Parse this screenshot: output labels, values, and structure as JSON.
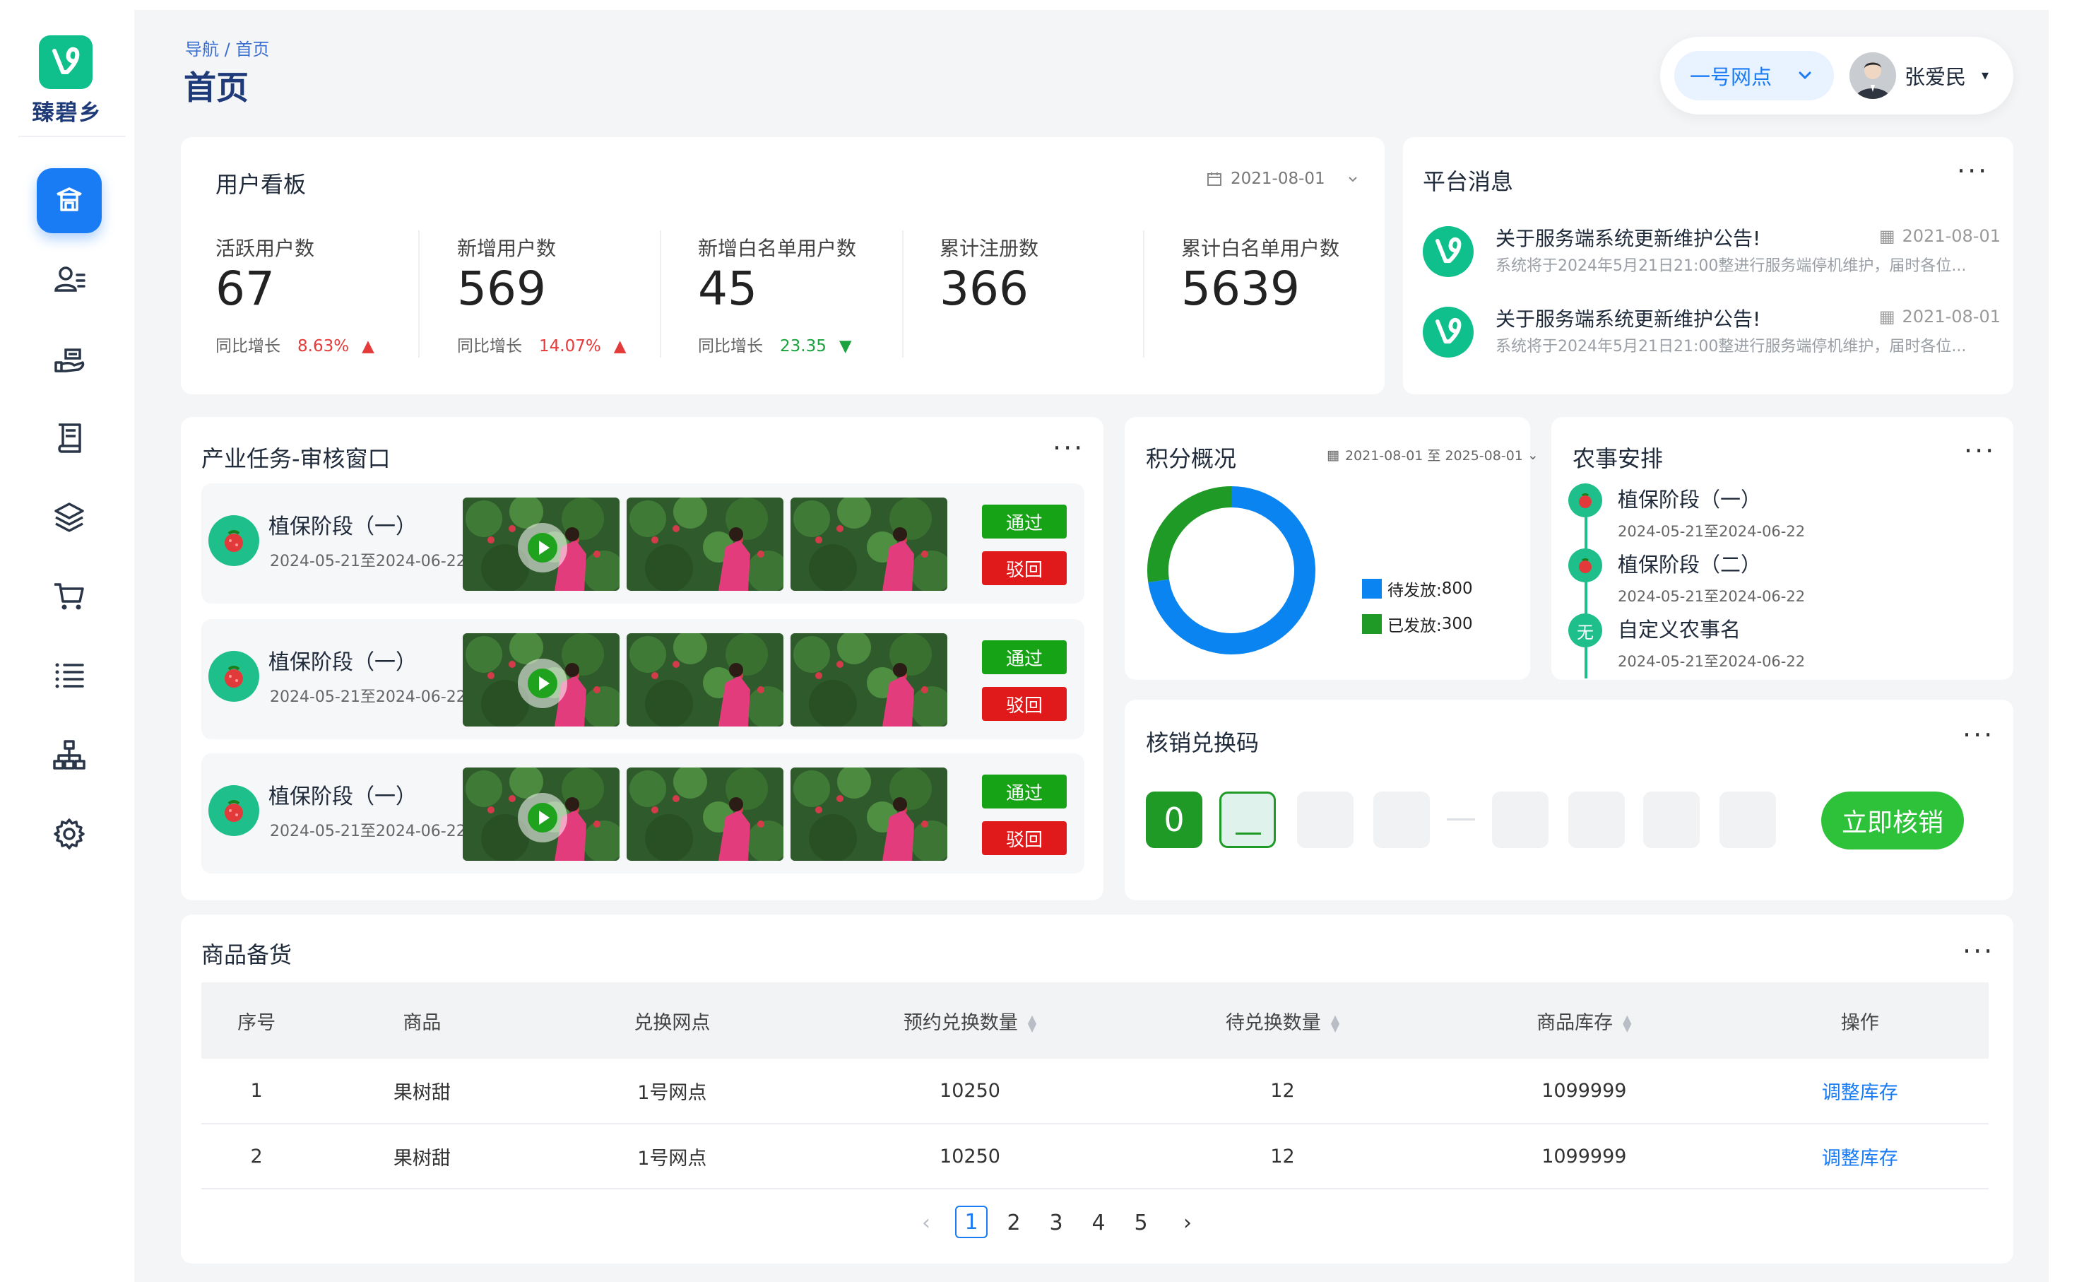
{
  "app": {
    "logo_text": "臻碧乡"
  },
  "nav": {
    "items": [
      "home-icon",
      "users-icon",
      "hand-coin-icon",
      "book-icon",
      "layers-icon",
      "cart-icon",
      "list-icon",
      "org-chart-icon",
      "gear-icon"
    ],
    "active": 0
  },
  "header": {
    "breadcrumb": "导航 / 首页",
    "title": "首页",
    "site_select": "一号网点",
    "user_name": "张爱民",
    "user_caret": "▾"
  },
  "user_board": {
    "title": "用户看板",
    "date": "2021-08-01",
    "stats": [
      {
        "label": "活跃用户数",
        "value": "67",
        "growth_label": "同比增长",
        "growth": "8.63%",
        "trend": "up"
      },
      {
        "label": "新增用户数",
        "value": "569",
        "growth_label": "同比增长",
        "growth": "14.07%",
        "trend": "up"
      },
      {
        "label": "新增白名单用户数",
        "value": "45",
        "growth_label": "同比增长",
        "growth": "23.35",
        "trend": "down"
      },
      {
        "label": "累计注册数",
        "value": "366"
      },
      {
        "label": "累计白名单用户数",
        "value": "5639"
      }
    ]
  },
  "messages": {
    "title": "平台消息",
    "items": [
      {
        "title": "关于服务端系统更新维护公告!",
        "date": "2021-08-01",
        "body": "系统将于2024年5月21日21:00整进行服务端停机维护，届时各位..."
      },
      {
        "title": "关于服务端系统更新维护公告!",
        "date": "2021-08-01",
        "body": "系统将于2024年5月21日21:00整进行服务端停机维护，届时各位..."
      }
    ]
  },
  "tasks": {
    "title": "产业任务-审核窗口",
    "pass_label": "通过",
    "reject_label": "驳回",
    "items": [
      {
        "name": "植保阶段（一）",
        "date": "2024-05-21至2024-06-22"
      },
      {
        "name": "植保阶段（一）",
        "date": "2024-05-21至2024-06-22"
      },
      {
        "name": "植保阶段（一）",
        "date": "2024-05-21至2024-06-22"
      }
    ]
  },
  "points": {
    "title": "积分概况",
    "date_range": "2021-08-01 至 2025-08-01",
    "legend": [
      {
        "label": "待发放:",
        "value": "800",
        "color": "#0a84f0"
      },
      {
        "label": "已发放:",
        "value": "300",
        "color": "#1f9a26"
      }
    ]
  },
  "chart_data": {
    "type": "pie",
    "categories": [
      "待发放",
      "已发放"
    ],
    "values": [
      800,
      300
    ],
    "colors": [
      "#0a84f0",
      "#1f9a26"
    ]
  },
  "farm": {
    "title": "农事安排",
    "items": [
      {
        "name": "植保阶段（一）",
        "date": "2024-05-21至2024-06-22",
        "badge": ""
      },
      {
        "name": "植保阶段（二）",
        "date": "2024-05-21至2024-06-22",
        "badge": ""
      },
      {
        "name": "自定义农事名",
        "date": "2024-05-21至2024-06-22",
        "badge": "无"
      }
    ]
  },
  "redeem": {
    "title": "核销兑换码",
    "digit": "0",
    "button": "立即核销"
  },
  "stock": {
    "title": "商品备货",
    "columns": [
      "序号",
      "商品",
      "兑换网点",
      "预约兑换数量",
      "待兑换数量",
      "商品库存",
      "操作"
    ],
    "rows": [
      [
        "1",
        "果树甜",
        "1号网点",
        "10250",
        "12",
        "1099999",
        "调整库存"
      ],
      [
        "2",
        "果树甜",
        "1号网点",
        "10250",
        "12",
        "1099999",
        "调整库存"
      ]
    ],
    "pages": [
      "1",
      "2",
      "3",
      "4",
      "5"
    ],
    "current_page": "1",
    "prev": "‹",
    "next": "›"
  },
  "colors": {
    "primary": "#1a7cf5",
    "brand": "#0fbf8c",
    "pass": "#16a316",
    "reject": "#e01a1a"
  }
}
